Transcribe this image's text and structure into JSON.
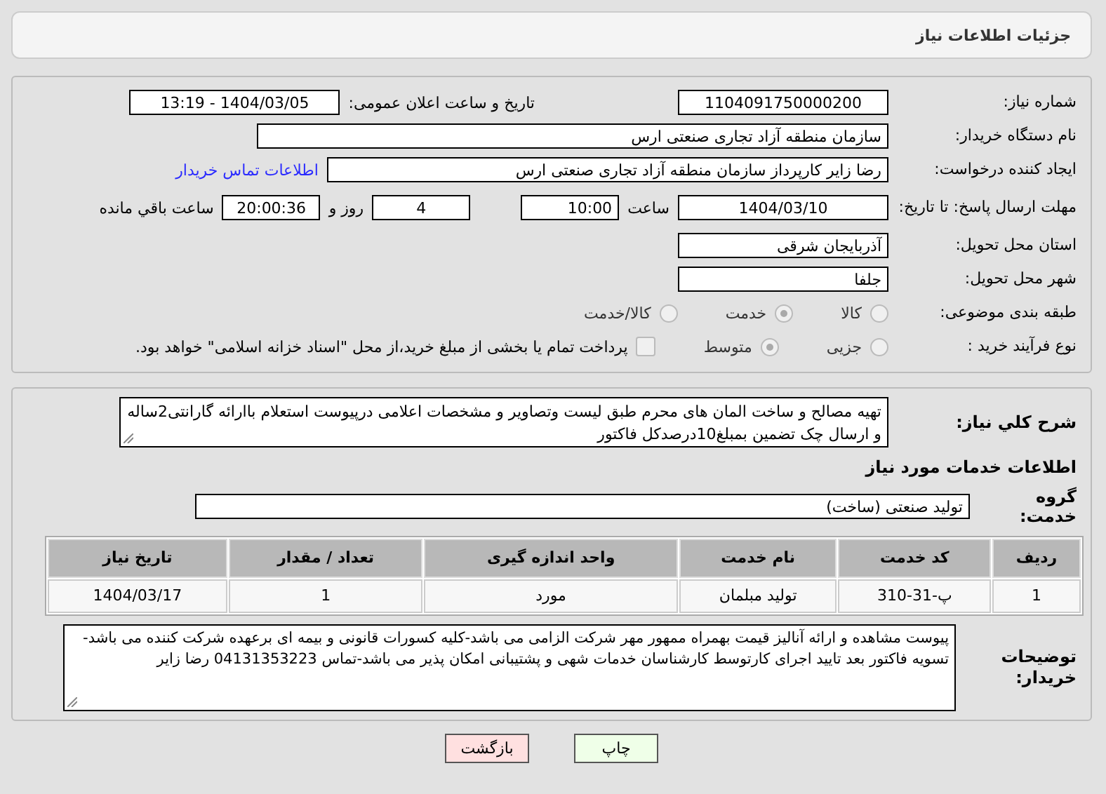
{
  "header": {
    "title": "جزئیات اطلاعات نیاز"
  },
  "need_number": {
    "label": "شماره نیاز:",
    "value": "1104091750000200"
  },
  "announce": {
    "label": "تاریخ و ساعت اعلان عمومی:",
    "value": "1404/03/05 - 13:19"
  },
  "buyer_org": {
    "label": "نام دستگاه خریدار:",
    "value": "سازمان منطقه آزاد تجاری صنعتی ارس"
  },
  "requester": {
    "label": "ایجاد کننده درخواست:",
    "value": "رضا زایر کارپرداز سازمان منطقه آزاد تجاری صنعتی ارس",
    "link": "اطلاعات تماس خریدار"
  },
  "deadline": {
    "label": "مهلت ارسال پاسخ: تا تاریخ:",
    "date": "1404/03/10",
    "time_label": "ساعت",
    "time": "10:00",
    "days": "4",
    "days_label": "روز و",
    "remaining": "20:00:36",
    "remaining_label": "ساعت باقي مانده"
  },
  "province": {
    "label": "استان محل تحویل:",
    "value": "آذربایجان شرقی"
  },
  "city": {
    "label": "شهر محل تحویل:",
    "value": "جلفا"
  },
  "category": {
    "label": "طبقه بندی موضوعی:",
    "options": [
      {
        "label": "کالا",
        "selected": false
      },
      {
        "label": "خدمت",
        "selected": true
      },
      {
        "label": "کالا/خدمت",
        "selected": false
      }
    ]
  },
  "purchase_type": {
    "label": "نوع فرآیند خرید :",
    "options": [
      {
        "label": "جزیی",
        "selected": false
      },
      {
        "label": "متوسط",
        "selected": true
      }
    ],
    "treasury": {
      "checked": false,
      "text": "پرداخت تمام یا بخشی از مبلغ خرید،از محل \"اسناد خزانه اسلامی\" خواهد بود."
    }
  },
  "description": {
    "label": "شرح کلي نیاز:",
    "value": "تهیه مصالح و ساخت المان های محرم طبق لیست وتصاویر و مشخصات اعلامی درپیوست استعلام باارائه گارانتی2ساله و ارسال چک تضمین بمبلغ10درصدکل فاکتور"
  },
  "services_heading": "اطلاعات خدمات مورد نیاز",
  "service_group": {
    "label": "گروه خدمت:",
    "value": "تولید صنعتی (ساخت)"
  },
  "table": {
    "columns": [
      "ردیف",
      "کد خدمت",
      "نام خدمت",
      "واحد اندازه گیری",
      "تعداد / مقدار",
      "تاریخ نیاز"
    ],
    "rows": [
      [
        "1",
        "پ-31-310",
        "تولید مبلمان",
        "مورد",
        "1",
        "1404/03/17"
      ]
    ]
  },
  "buyer_notes": {
    "label": "توضیحات خریدار:",
    "value": "پیوست مشاهده و ارائه آنالیز قیمت بهمراه ممهور مهر شرکت الزامی می باشد-کلیه کسورات قانونی و بیمه ای برعهده شرکت کننده می باشد-تسویه فاکتور بعد تایید اجرای کارتوسط کارشناسان خدمات شهی و پشتیبانی امکان پذیر می باشد-تماس 04131353223 رضا زایر"
  },
  "buttons": [
    {
      "label": "چاپ",
      "kind": "print"
    },
    {
      "label": "بازگشت",
      "kind": "back"
    }
  ]
}
